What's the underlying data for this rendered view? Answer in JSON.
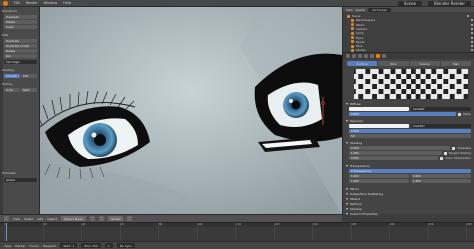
{
  "app": {
    "menus": [
      "File",
      "Render",
      "Window",
      "Help"
    ],
    "scene_label": "Scene",
    "render_engine": "Blender Render"
  },
  "toolshelf": {
    "sections": [
      "Transform",
      "Edit",
      "History"
    ],
    "items": [
      "Translate",
      "Rotate",
      "Scale",
      "Duplicate",
      "Duplicate Linked",
      "Delete",
      "Join",
      "Set Origin",
      "Shading",
      "Smooth",
      "Flat",
      "Undo",
      "Redo"
    ],
    "bottom_label": "Translate",
    "bottom_value": "Global"
  },
  "viewport_header": {
    "items": [
      "View",
      "Select",
      "Add",
      "Object"
    ],
    "mode": "Object Mode",
    "shading_label": "Global"
  },
  "timeline": {
    "ticks": [
      "0",
      "20",
      "40",
      "60",
      "80",
      "100",
      "120",
      "140",
      "160",
      "180",
      "200",
      "220",
      "240"
    ],
    "playhead_frame": 1
  },
  "statusbar": {
    "items": [
      "View",
      "Marker",
      "Frame",
      "Playback"
    ],
    "start_label": "Start: 1",
    "end_label": "End: 250",
    "current_frame": "1",
    "sync": "No Sync"
  },
  "outliner": {
    "view_label": "View",
    "search_label": "Search",
    "filter": "All Scenes",
    "rows": [
      "Scene",
      "RenderLayers",
      "World",
      "Camera",
      "Lamp",
      "Eye.L",
      "Eye.R",
      "Face",
      "Lashes"
    ]
  },
  "properties": {
    "subtabs": [
      "Surface",
      "Wire",
      "Volume",
      "Halo"
    ],
    "sections": [
      "Preview",
      "Diffuse",
      "Specular",
      "Shading",
      "Transparency",
      "Mirror",
      "Subsurface Scattering",
      "Strand",
      "Options",
      "Shadow",
      "Custom Properties"
    ],
    "diffuse": {
      "shader": "Lambert",
      "intensity": "0.800",
      "ramp": "Ramp"
    },
    "specular": {
      "shader": "CookTorr",
      "intensity": "0.500",
      "hardness": "50"
    },
    "shading": {
      "emit": "0.000",
      "ambient": "1.000",
      "translucency": "0.000",
      "shadeless": "Shadeless",
      "tangent": "Tangent Shading",
      "cubic": "Cubic Interpolation"
    },
    "transparency": {
      "mode": "Z Transparency",
      "alpha": "1.000",
      "fresnel": "0.000",
      "specular": "1.000",
      "blend": "1.250"
    }
  },
  "colors": {
    "accent": "#5680c2",
    "orange": "#e87d0d",
    "skin": "#b6c2c6",
    "iris": "#4e88b0"
  }
}
